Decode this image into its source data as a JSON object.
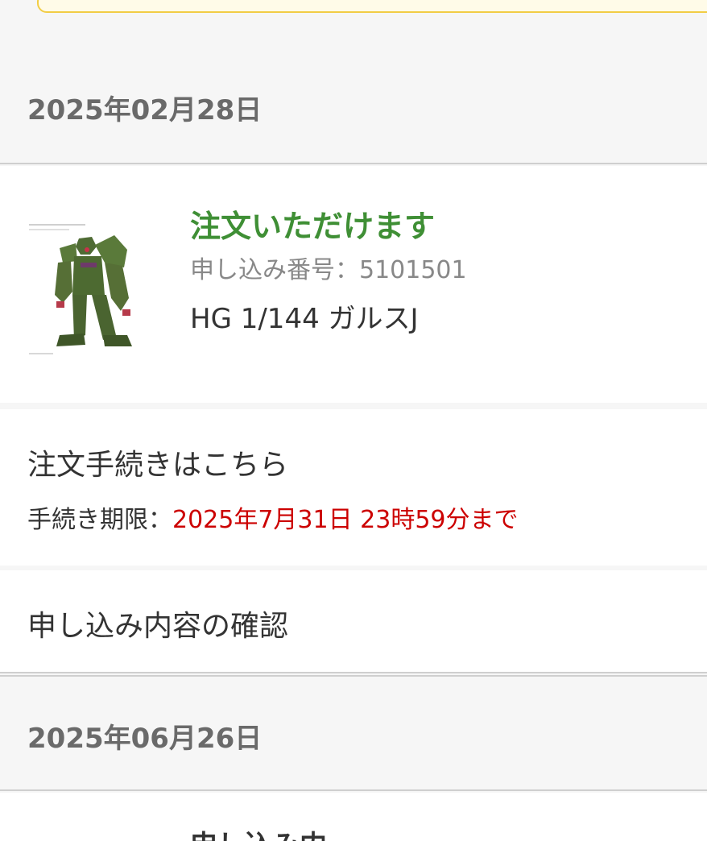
{
  "groups": [
    {
      "date": "2025年02月28日",
      "item": {
        "status": "注文いただけます",
        "application_number_label": "申し込み番号：",
        "application_number": "5101501",
        "product_name": "HG 1/144 ガルスJ",
        "thumbnail_icon": "gundam-figure-image"
      },
      "order_link": {
        "label": "注文手続きはこちら",
        "deadline_label": "手続き期限：",
        "deadline_value": "2025年7月31日 23時59分まで"
      },
      "confirm_link": {
        "label": "申し込み内容の確認"
      }
    },
    {
      "date": "2025年06月26日",
      "item": {
        "partial_text": "申し込み内"
      }
    }
  ],
  "colors": {
    "status_green": "#3f8f35",
    "deadline_red": "#cc0000",
    "notice_border": "#f2cd45"
  }
}
